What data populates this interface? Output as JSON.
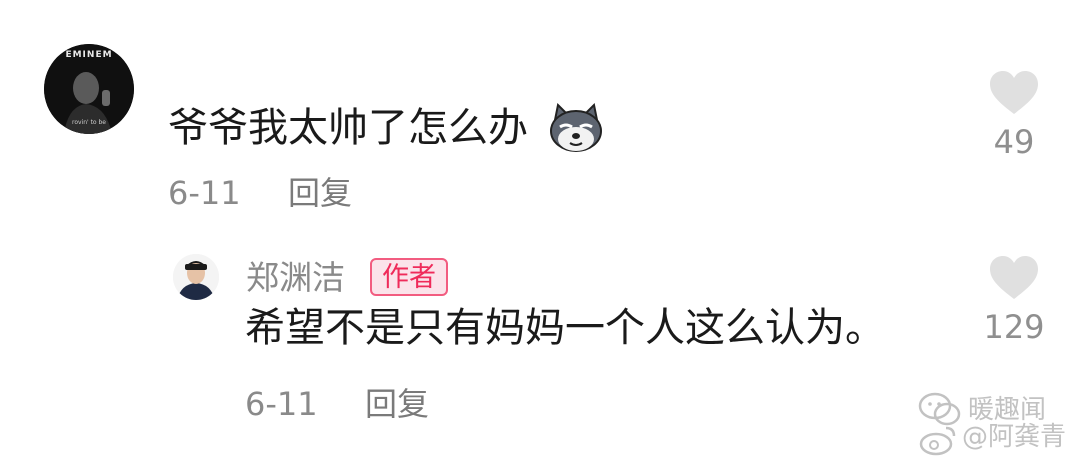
{
  "comment": {
    "avatar": {
      "brand": "EMINEM",
      "tagline": "rovin' to be"
    },
    "text": "爷爷我太帅了怎么办",
    "emoji": "shiba-dog-emoji",
    "date": "6-11",
    "reply_label": "回复",
    "likes": "49"
  },
  "reply": {
    "author": "郑渊洁",
    "author_badge": "作者",
    "text": "希望不是只有妈妈一个人这么认为。",
    "date": "6-11",
    "reply_label": "回复",
    "likes": "129"
  },
  "watermark": {
    "line1": "暖趣闻",
    "line2": "@阿龚青"
  },
  "colors": {
    "text": "#1a1a1a",
    "meta": "#8a8a8a",
    "like": "#e0e0e0",
    "badge_fg": "#ef2b5a",
    "badge_bg": "#fbe3ea"
  }
}
